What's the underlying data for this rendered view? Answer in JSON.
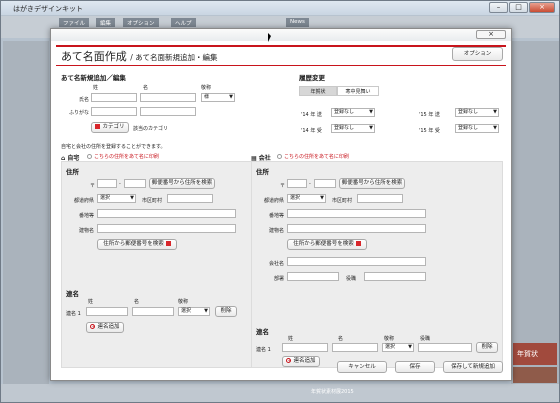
{
  "app": {
    "title": "はがきデザインキット",
    "bg_texts": {
      "tab1": "ファイル",
      "tab2": "編集",
      "tab3": "オプション",
      "tab4": "ヘルプ",
      "tab5": "News",
      "bg_right": "年賀状",
      "bg_banner": "年賀状素材展2015"
    }
  },
  "dialog": {
    "close_label": "×",
    "title": "あて名面作成",
    "subtitle": "/ あて名面新規追加・編集",
    "option_button": "オプション",
    "new_section": {
      "title": "あて名新規追加／編集",
      "col_sei": "姓",
      "col_mei": "名",
      "col_keisho": "敬称",
      "label_name": "氏名",
      "label_furigana": "ふりがな",
      "keisho_value": "様",
      "category_button": "カテゴリ",
      "category_value": "該当のカテゴリ"
    },
    "history": {
      "title": "履歴変更",
      "tab_nenga": "年賀状",
      "tab_kanchu": "寒中見舞い",
      "rows": [
        {
          "year": "'14 年",
          "kind": "送",
          "value": "登録なし"
        },
        {
          "year": "'15 年",
          "kind": "送",
          "value": "登録なし"
        },
        {
          "year": "'14 年",
          "kind": "受",
          "value": "登録なし"
        },
        {
          "year": "'15 年",
          "kind": "受",
          "value": "登録なし"
        }
      ]
    },
    "note": "自宅と会社の住所を登録することができます。",
    "home": {
      "label": "自宅",
      "radio_label": "こちらの住所をあて名に印刷",
      "addr_title": "住所",
      "postal_mark": "〒",
      "postal_sep": "-",
      "postal_button": "郵便番号から住所を検索",
      "pref_label": "都道府県",
      "pref_value": "選択",
      "city_label": "市区町村",
      "street_label": "番地等",
      "building_label": "建物名",
      "addr_button": "住所から郵便番号を検索",
      "joint": {
        "title": "連名",
        "col_sei": "姓",
        "col_mei": "名",
        "col_keisho": "敬称",
        "row_label": "連名 1",
        "keisho_value": "選択",
        "delete_button": "削除",
        "add_button": "連名追加"
      }
    },
    "company": {
      "label": "会社",
      "radio_label": "こちらの住所をあて名に印刷",
      "addr_title": "住所",
      "postal_mark": "〒",
      "postal_sep": "-",
      "postal_button": "郵便番号から住所を検索",
      "pref_label": "都道府県",
      "pref_value": "選択",
      "city_label": "市区町村",
      "street_label": "番地等",
      "building_label": "建物名",
      "addr_button": "住所から郵便番号を検索",
      "company_label": "会社名",
      "dept_label": "部署",
      "role_label": "役職",
      "joint": {
        "title": "連名",
        "col_sei": "姓",
        "col_mei": "名",
        "col_keisho": "敬称",
        "col_role": "役職",
        "row_label": "連名 1",
        "keisho_value": "選択",
        "delete_button": "削除",
        "add_button": "連名追加"
      }
    },
    "footer": {
      "cancel": "キャンセル",
      "save": "保存",
      "save_new": "保存して新規追加"
    }
  }
}
